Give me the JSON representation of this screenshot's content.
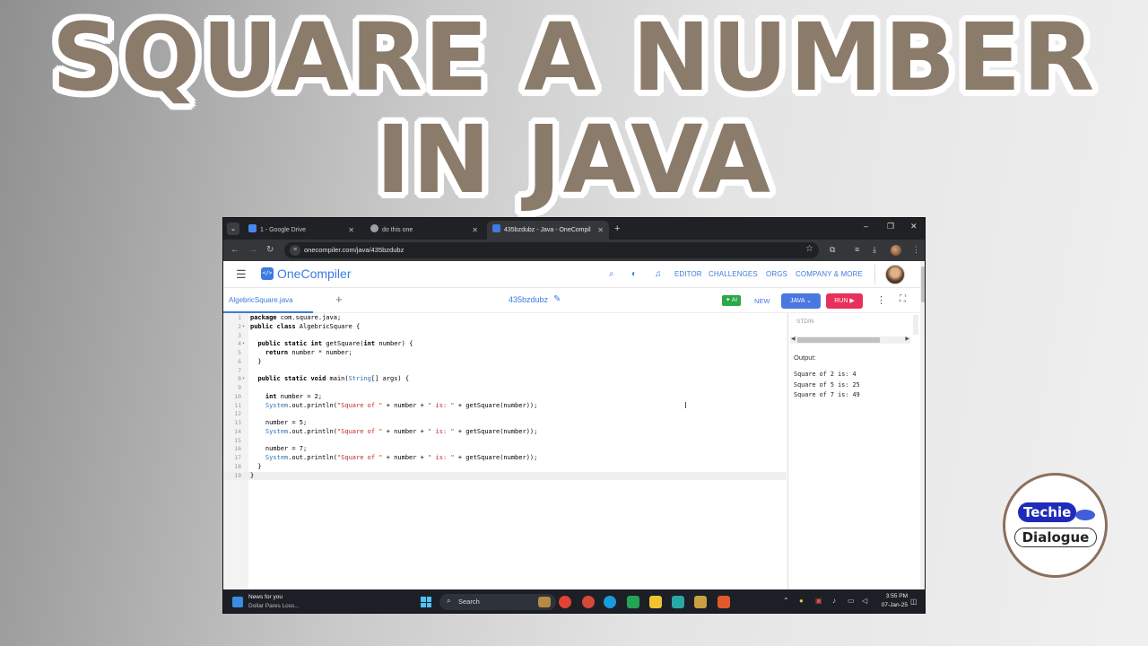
{
  "thumbnail": {
    "title_line1": "SQUARE A NUMBER",
    "title_line2": "IN JAVA"
  },
  "browser": {
    "tabs": [
      {
        "label": "1 - Google Drive",
        "icon": "google-docs-icon",
        "active": false
      },
      {
        "label": "do this one",
        "icon": "globe-icon",
        "active": false
      },
      {
        "label": "435bzdubz - Java - OneCompil",
        "icon": "onecompiler-icon",
        "active": true
      }
    ],
    "new_tab_glyph": "+",
    "url": "onecompiler.com/java/435bzdubz"
  },
  "site": {
    "logo_text": "OneCompiler",
    "nav": [
      "EDITOR",
      "CHALLENGES",
      "ORGS",
      "COMPANY & MORE"
    ]
  },
  "editor": {
    "file_tab": "AlgebricSquare.java",
    "project_name": "435bzdubz",
    "ai_label": "AI",
    "new_label": "NEW",
    "language": "JAVA",
    "run_label": "RUN",
    "code_lines": [
      "package com.square.java;",
      "public class AlgebricSquare {",
      "",
      "  public static int getSquare(int number) {",
      "    return number * number;",
      "  }",
      "",
      "  public static void main(String[] args) {",
      "",
      "    int number = 2;",
      "    System.out.println(\"Square of \" + number + \" is: \" + getSquare(number));",
      "",
      "    number = 5;",
      "    System.out.println(\"Square of \" + number + \" is: \" + getSquare(number));",
      "",
      "    number = 7;",
      "    System.out.println(\"Square of \" + number + \" is: \" + getSquare(number));",
      "  }",
      "}"
    ],
    "foldable_lines": [
      2,
      4,
      8
    ]
  },
  "io": {
    "stdin_label": "STDIN",
    "output_label": "Output:",
    "output_lines": [
      "Square of 2 is: 4",
      "Square of 5 is: 25",
      "Square of 7 is: 49"
    ]
  },
  "taskbar": {
    "news_title": "News for you",
    "news_sub": "Dollar Pares Loss...",
    "search_placeholder": "Search",
    "time": "3:55 PM",
    "date": "07-Jan-25"
  },
  "badge": {
    "line1": "Techie",
    "line2": "Dialogue"
  },
  "colors": {
    "title": "#8b7b6b",
    "accent_blue": "#3d7be0",
    "run_red": "#e8305c",
    "ai_green": "#2aa84a"
  }
}
